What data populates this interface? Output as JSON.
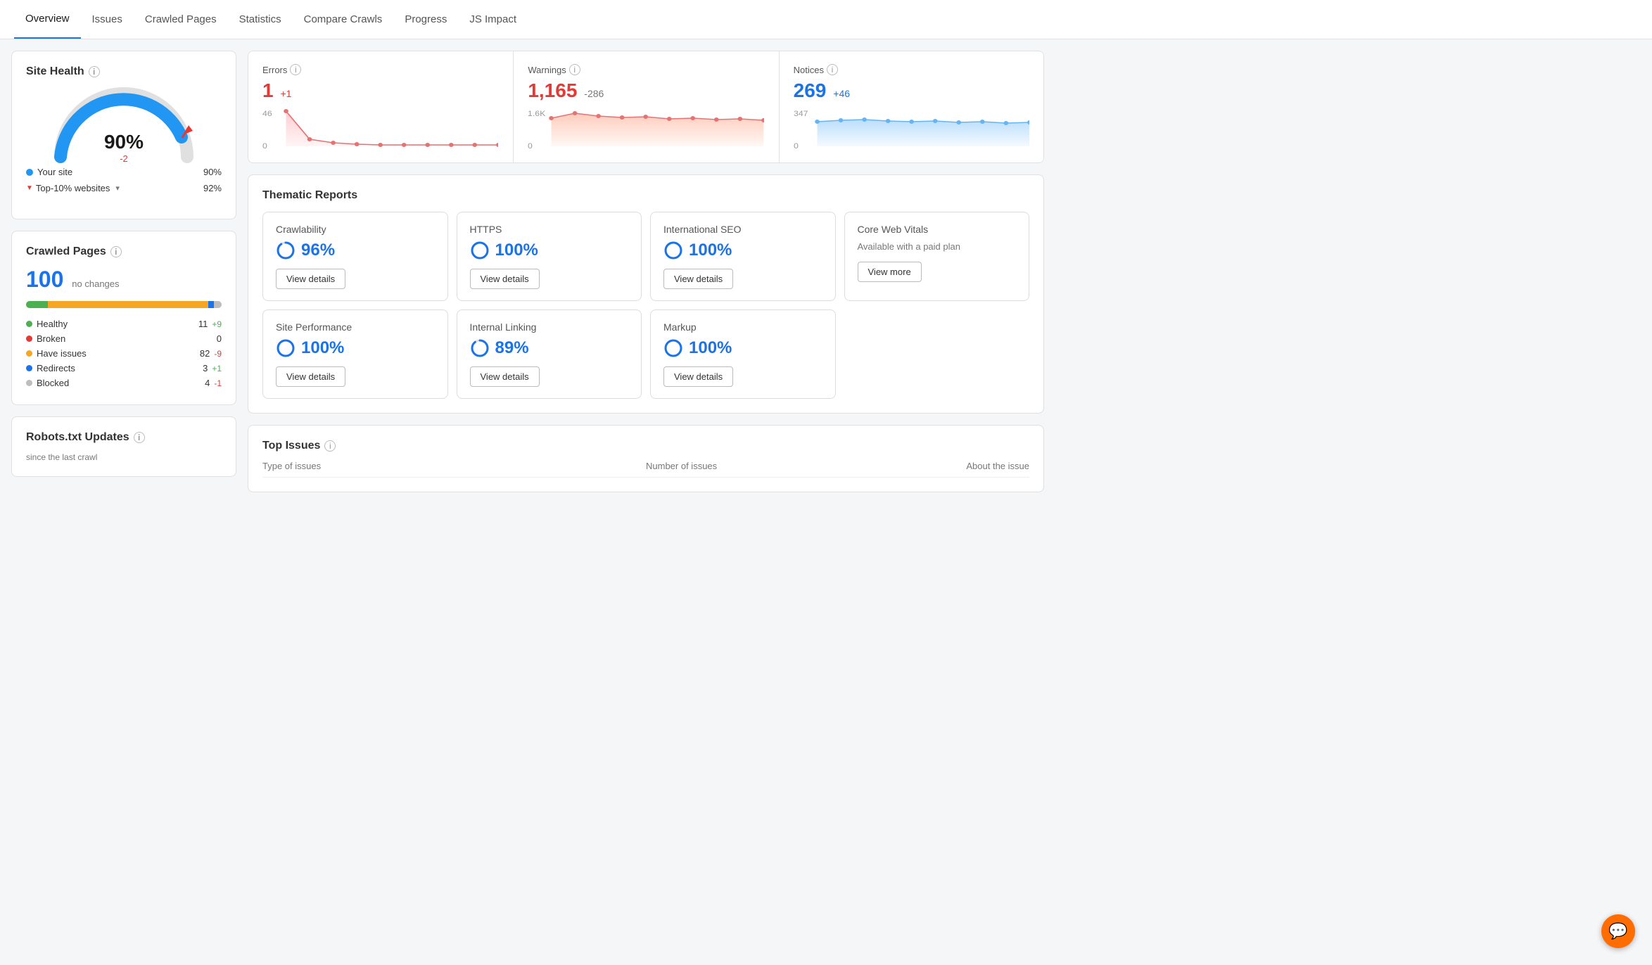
{
  "nav": {
    "tabs": [
      {
        "label": "Overview",
        "active": true
      },
      {
        "label": "Issues",
        "active": false
      },
      {
        "label": "Crawled Pages",
        "active": false
      },
      {
        "label": "Statistics",
        "active": false
      },
      {
        "label": "Compare Crawls",
        "active": false
      },
      {
        "label": "Progress",
        "active": false
      },
      {
        "label": "JS Impact",
        "active": false
      }
    ]
  },
  "site_health": {
    "title": "Site Health",
    "percent": "90%",
    "change": "-2",
    "your_site_label": "Your site",
    "your_site_val": "90%",
    "top10_label": "Top-10% websites",
    "top10_val": "92%"
  },
  "crawled_pages": {
    "title": "Crawled Pages",
    "count": "100",
    "note": "no changes",
    "stats": [
      {
        "label": "Healthy",
        "color": "#4caf50",
        "value": "11",
        "change": "+9",
        "change_type": "pos"
      },
      {
        "label": "Broken",
        "color": "#e53935",
        "value": "0",
        "change": "",
        "change_type": ""
      },
      {
        "label": "Have issues",
        "color": "#f5a623",
        "value": "82",
        "change": "-9",
        "change_type": "neg"
      },
      {
        "label": "Redirects",
        "color": "#1a73e8",
        "value": "3",
        "change": "+1",
        "change_type": "pos"
      },
      {
        "label": "Blocked",
        "color": "#bdbdbd",
        "value": "4",
        "change": "-1",
        "change_type": "neg"
      }
    ],
    "bar": [
      {
        "color": "#4caf50",
        "width": 11
      },
      {
        "color": "#f5a623",
        "width": 82
      },
      {
        "color": "#1a73e8",
        "width": 3
      },
      {
        "color": "#bdbdbd",
        "width": 4
      }
    ]
  },
  "robots_txt": {
    "title": "Robots.txt Updates",
    "since": "since the last crawl"
  },
  "errors": {
    "label": "Errors",
    "value": "1",
    "change": "+1",
    "change_type": "red",
    "y_max": "46",
    "y_min": "0"
  },
  "warnings": {
    "label": "Warnings",
    "value": "1,165",
    "change": "-286",
    "change_type": "black",
    "y_max": "1.6K",
    "y_min": "0"
  },
  "notices": {
    "label": "Notices",
    "value": "269",
    "change": "+46",
    "change_type": "blue",
    "y_max": "347",
    "y_min": "0"
  },
  "thematic_reports": {
    "title": "Thematic Reports",
    "row1": [
      {
        "name": "Crawlability",
        "score": "96%",
        "btn": "View details",
        "paid": false
      },
      {
        "name": "HTTPS",
        "score": "100%",
        "btn": "View details",
        "paid": false
      },
      {
        "name": "International SEO",
        "score": "100%",
        "btn": "View details",
        "paid": false
      },
      {
        "name": "Core Web Vitals",
        "score": "",
        "btn": "View more",
        "paid": true,
        "paid_text": "Available with a paid plan"
      }
    ],
    "row2": [
      {
        "name": "Site Performance",
        "score": "100%",
        "btn": "View details",
        "paid": false
      },
      {
        "name": "Internal Linking",
        "score": "89%",
        "btn": "View details",
        "paid": false
      },
      {
        "name": "Markup",
        "score": "100%",
        "btn": "View details",
        "paid": false
      }
    ]
  },
  "top_issues": {
    "title": "Top Issues",
    "col_type": "Type of issues",
    "col_num": "Number of issues",
    "col_about": "About the issue"
  }
}
